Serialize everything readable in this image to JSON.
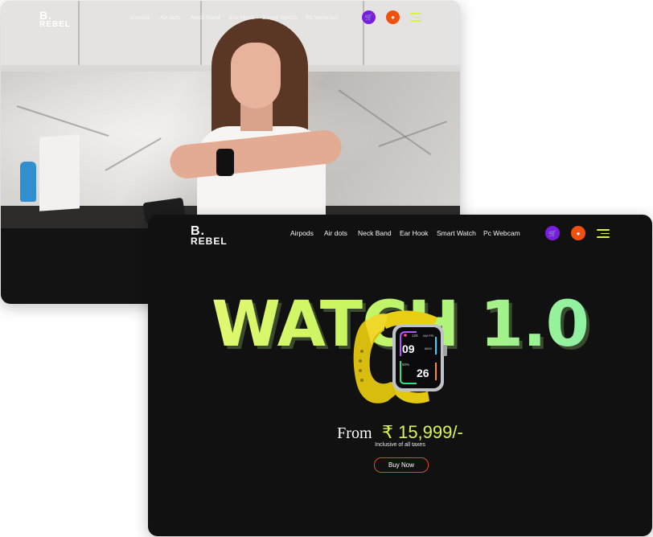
{
  "brand": {
    "logo_top": "B.",
    "logo_bottom": "REBEL"
  },
  "nav": {
    "links": [
      "Airpods",
      "Air dots",
      "Neck Band",
      "Ear Hook",
      "Smart Watch",
      "Pc Webcam"
    ],
    "cart_icon": "cart-icon",
    "user_icon": "user-icon",
    "menu_icon": "hamburger-menu-icon"
  },
  "hero": {
    "title": "WATCH 1.0",
    "price_prefix": "From",
    "price": "₹ 15,999/-",
    "tax_note": "Inclusive of all taxes",
    "cta": "Buy Now"
  },
  "watch_screen": {
    "hours": "09",
    "minutes": "26",
    "top_left": "120",
    "top_right": "AM FRI",
    "mid_right": "6800",
    "bottom_left": "50%"
  },
  "colors": {
    "background": "#121112",
    "accent_lime": "#dcf54a",
    "cart_button": "#7b1de0",
    "user_button": "#f0510f",
    "cta_border": "#e24a1a",
    "watch_strap": "#e9cf14"
  }
}
